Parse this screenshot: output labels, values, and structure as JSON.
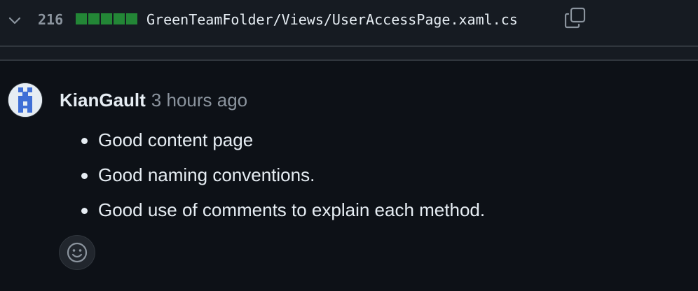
{
  "file_header": {
    "line_count": "216",
    "path": "GreenTeamFolder/Views/UserAccessPage.xaml.cs",
    "diffstat": [
      "added",
      "added",
      "added",
      "added",
      "added"
    ],
    "expand_icon": "chevron-down-icon",
    "copy_icon": "copy-icon"
  },
  "comment": {
    "author": "KianGault",
    "timestamp": "3 hours ago",
    "bullets": [
      "Good content page",
      "Good naming conventions.",
      "Good use of comments to explain each method."
    ],
    "reaction_icon": "smiley-icon"
  },
  "colors": {
    "background": "#0d1117",
    "header_background": "#161b22",
    "border": "#30363d",
    "diff_added": "#238636",
    "muted_text": "#8b949e",
    "text": "#e6edf3",
    "avatar_accent": "#3f6fd6"
  }
}
